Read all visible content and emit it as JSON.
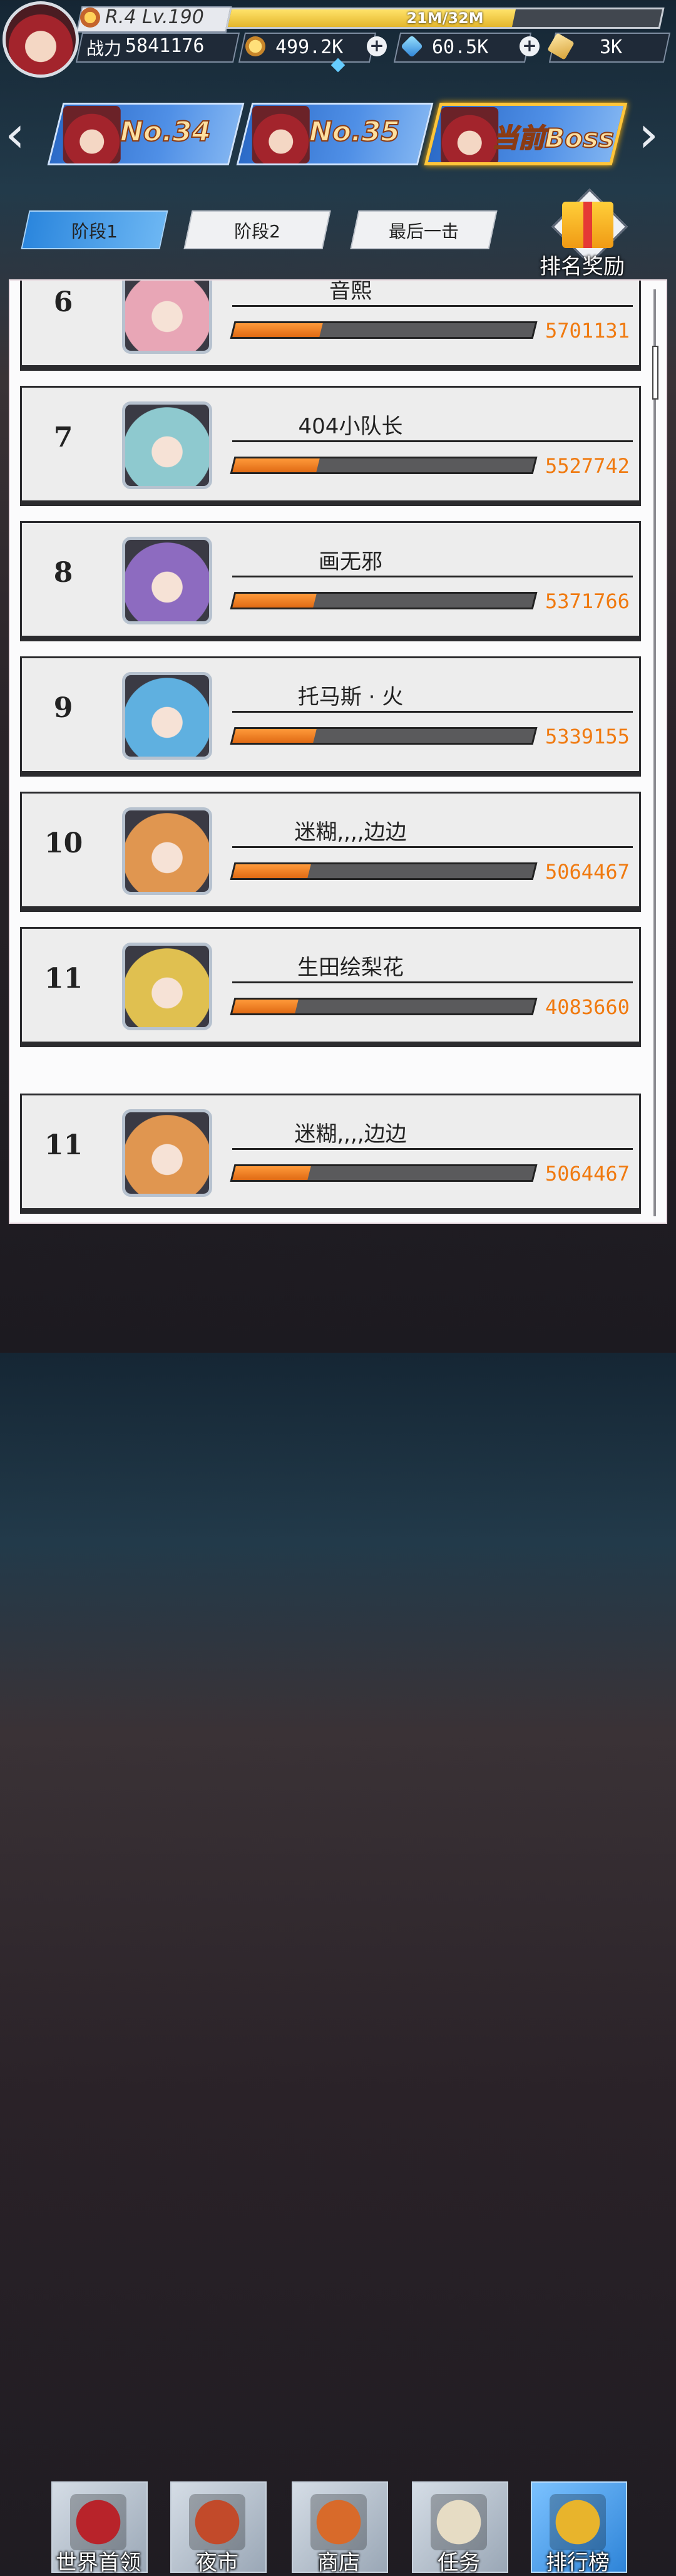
{
  "header": {
    "level_text": "R.4 Lv.190",
    "exp_text": "21M/32M",
    "exp_fraction": 0.66,
    "power_label": "战力",
    "power_value": "5841176",
    "coins": "499.2K",
    "gems": "60.5K",
    "tickets": "3K"
  },
  "boss_tabs": [
    {
      "label": "No.34",
      "active": false
    },
    {
      "label": "No.35",
      "active": false
    },
    {
      "label": "当前Boss",
      "active": true
    }
  ],
  "stage_tabs": [
    {
      "label": "阶段1",
      "active": true
    },
    {
      "label": "阶段2",
      "active": false
    },
    {
      "label": "最后一击",
      "active": false
    }
  ],
  "rank_reward_label": "排名奖励",
  "ranking": [
    {
      "rank": "6",
      "name": "音熙",
      "score": "5701131",
      "fill": 0.29,
      "avatar_color": "#e8a6b6"
    },
    {
      "rank": "7",
      "name": "404小队长",
      "score": "5527742",
      "fill": 0.28,
      "avatar_color": "#8ec9cf"
    },
    {
      "rank": "8",
      "name": "画无邪",
      "score": "5371766",
      "fill": 0.27,
      "avatar_color": "#8d6bc0"
    },
    {
      "rank": "9",
      "name": "托马斯 · 火",
      "score": "5339155",
      "fill": 0.27,
      "avatar_color": "#5fb0e0"
    },
    {
      "rank": "10",
      "name": "迷糊,,,,边边",
      "score": "5064467",
      "fill": 0.25,
      "avatar_color": "#e09650"
    },
    {
      "rank": "11",
      "name": "生田绘梨花",
      "score": "4083660",
      "fill": 0.21,
      "avatar_color": "#e0c050"
    },
    {
      "rank": "11",
      "name": "迷糊,,,,边边",
      "score": "5064467",
      "fill": 0.25,
      "avatar_color": "#e09650"
    }
  ],
  "nav": [
    {
      "label": "世界首领",
      "icon": "demon-mask-icon",
      "active": false,
      "color": "#b8232a"
    },
    {
      "label": "夜市",
      "icon": "torii-gate-icon",
      "active": false,
      "color": "#c24a2a"
    },
    {
      "label": "商店",
      "icon": "shop-stall-icon",
      "active": false,
      "color": "#d86a2a"
    },
    {
      "label": "任务",
      "icon": "scroll-medal-icon",
      "active": false,
      "color": "#e6dcc4"
    },
    {
      "label": "排行榜",
      "icon": "trophy-icon",
      "active": true,
      "color": "#e8b42c"
    }
  ]
}
